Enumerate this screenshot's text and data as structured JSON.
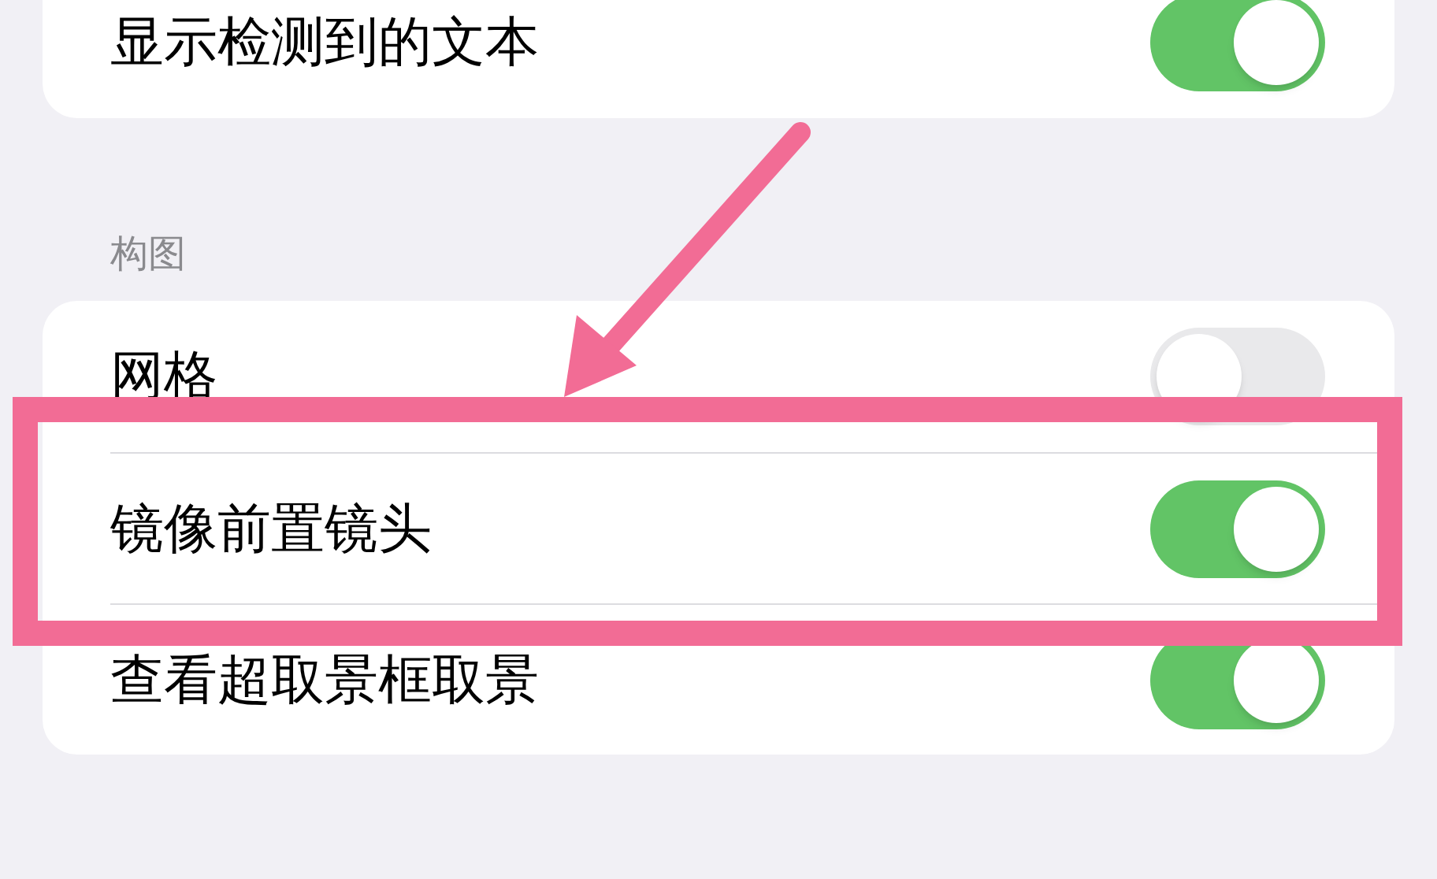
{
  "sections": [
    {
      "rows": [
        {
          "label": "显示检测到的文本",
          "on": true
        }
      ]
    },
    {
      "header": "构图",
      "rows": [
        {
          "label": "网格",
          "on": false
        },
        {
          "label": "镜像前置镜头",
          "on": true
        },
        {
          "label": "查看超取景框取景",
          "on": true
        }
      ]
    }
  ]
}
